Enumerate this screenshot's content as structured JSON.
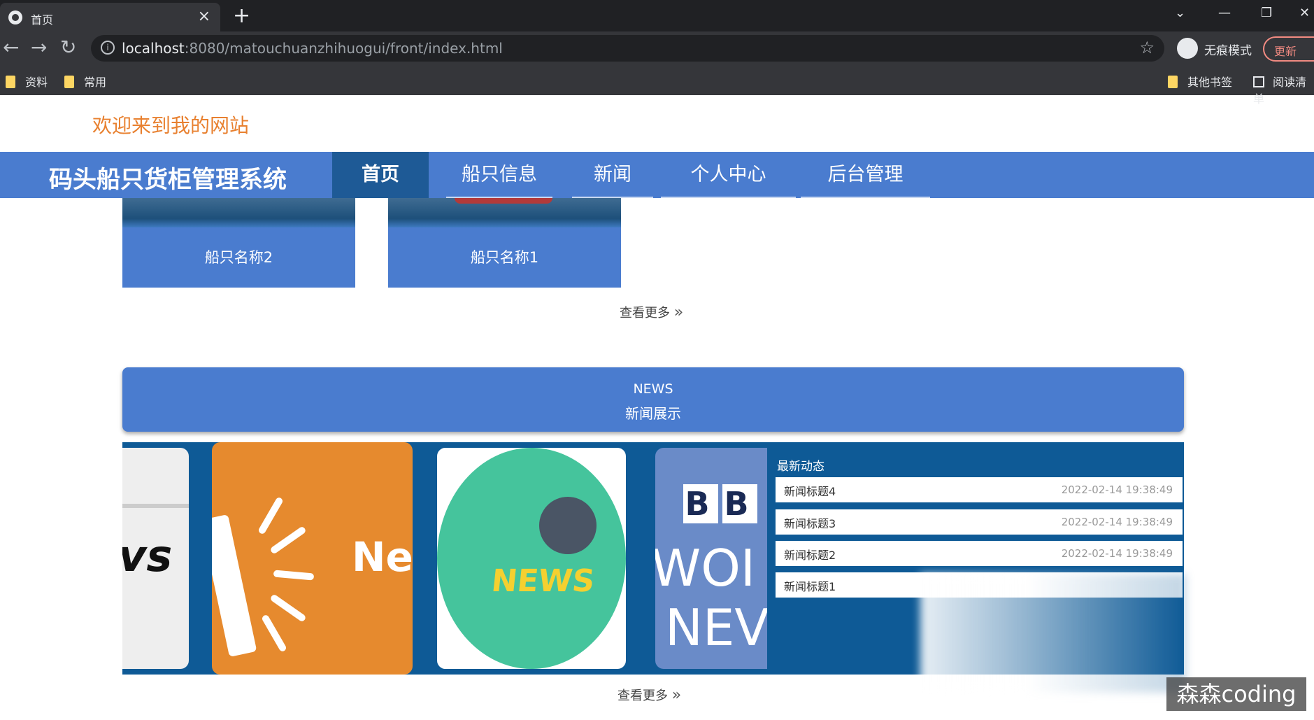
{
  "browser": {
    "tab_title": "首页",
    "tab_close": "×",
    "new_tab": "+",
    "url_host": "localhost",
    "url_path": ":8080/matouchuanzhihuogui/front/index.html",
    "incognito_label": "无痕模式",
    "update_label": "更新",
    "bookmarks": [
      "资料",
      "常用"
    ],
    "other_bookmarks": "其他书签",
    "reading_list": "阅读清单"
  },
  "page": {
    "welcome": "欢迎来到我的网站",
    "site_title": "码头船只货柜管理系统",
    "nav": [
      "首页",
      "船只信息",
      "新闻",
      "个人中心",
      "后台管理"
    ],
    "ships": [
      {
        "name": "船只名称2"
      },
      {
        "name": "船只名称1"
      }
    ],
    "more_label": "查看更多",
    "news_banner_en": "NEWS",
    "news_banner_cn": "新闻展示",
    "latest_title": "最新动态",
    "news_items": [
      {
        "title": "新闻标题4",
        "date": "2022-02-14 19:38:49"
      },
      {
        "title": "新闻标题3",
        "date": "2022-02-14 19:38:49"
      },
      {
        "title": "新闻标题2",
        "date": "2022-02-14 19:38:49"
      },
      {
        "title": "新闻标题1",
        "date": ""
      }
    ],
    "thumb_text": {
      "paper": "vs",
      "orange": "Ne",
      "green": "NEWS",
      "bbc_letters": [
        "B",
        "B"
      ],
      "bbc_line1": "WOI",
      "bbc_line2": "NEV"
    }
  },
  "watermark": "森森coding",
  "colors": {
    "nav_bar": "#4a7ccf",
    "nav_active": "#1e5a96",
    "welcome_text": "#e8802f",
    "news_panel": "#0e5a96"
  },
  "icons": [
    "globe-icon",
    "close-icon",
    "plus-icon",
    "back-arrow-icon",
    "forward-arrow-icon",
    "reload-icon",
    "info-icon",
    "star-icon",
    "incognito-icon",
    "folder-icon",
    "reading-list-icon",
    "chevron-down-icon",
    "minimize-icon",
    "restore-icon",
    "window-close-icon",
    "double-chevron-right-icon"
  ]
}
